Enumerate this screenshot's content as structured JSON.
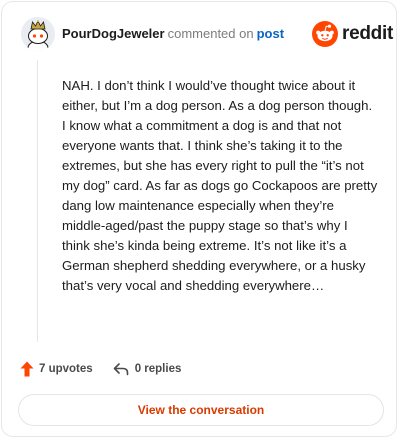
{
  "header": {
    "username": "PourDogJeweler",
    "commented_text": "commented on",
    "post_link": "post",
    "brand": "reddit",
    "avatar_icon": "avatar-icon",
    "brand_icon": "reddit-logo-icon"
  },
  "comment": {
    "body": "NAH. I don’t think I would’ve thought twice about it either, but I’m a dog person. As a dog person though. I know what a commitment a dog is and that not everyone wants that. I think she’s taking it to the extremes, but she has every right to pull the “it’s not my dog” card. As far as dogs go Cockapoos are pretty dang low maintenance especially when they’re middle-aged/past the puppy stage so that’s why I think she’s kinda being extreme. It’s not like it’s a German shepherd shedding everywhere, or a husky that’s very vocal and shedding everywhere…"
  },
  "actions": {
    "upvotes": "7 upvotes",
    "replies": "0 replies",
    "upvote_icon": "upvote-arrow-icon",
    "reply_icon": "reply-arrow-icon"
  },
  "footer": {
    "button_label": "View the conversation"
  },
  "colors": {
    "brand": "#ff4500",
    "link": "#0a66c2",
    "button_text": "#d93a00",
    "border": "#e5e7eb"
  }
}
